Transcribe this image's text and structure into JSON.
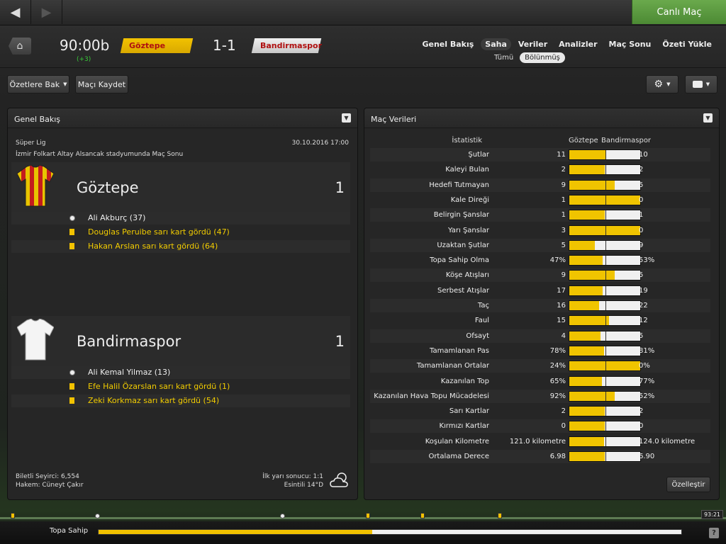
{
  "topbar": {
    "back_icon": "arrow-left-icon",
    "forward_icon": "arrow-right-icon",
    "live_label": "Canlı Maç"
  },
  "header": {
    "clock": "90:00b",
    "added_time": "(+3)",
    "home_team": "Göztepe",
    "score": "1-1",
    "away_team": "Bandirmaspor",
    "tabs": [
      {
        "label": "Genel Bakış"
      },
      {
        "label": "Saha",
        "active": true
      },
      {
        "label": "Veriler"
      },
      {
        "label": "Analizler"
      },
      {
        "label": "Maç Sonu"
      },
      {
        "label": "Özeti Yükle"
      }
    ],
    "subtabs": [
      {
        "label": "Tümü"
      },
      {
        "label": "Bölünmüş",
        "active": true
      }
    ]
  },
  "toolbar": {
    "highlights_label": "Özetlere Bak",
    "save_label": "Maçı Kaydet"
  },
  "overview": {
    "title": "Genel Bakış",
    "league": "Süper Lig",
    "kickoff": "30.10.2016 17:00",
    "venue": "İzmir Folkart Altay Alsancak stadyumunda Maç Sonu",
    "home": {
      "name": "Göztepe",
      "goals": "1",
      "events": [
        {
          "type": "goal",
          "text": "Ali Akburç (37)"
        },
        {
          "type": "card",
          "text": "Douglas Peruibe sarı kart gördü (47)"
        },
        {
          "type": "card",
          "text": "Hakan Arslan sarı kart gördü (64)"
        }
      ]
    },
    "away": {
      "name": "Bandirmaspor",
      "goals": "1",
      "events": [
        {
          "type": "goal",
          "text": "Ali Kemal Yilmaz (13)"
        },
        {
          "type": "card",
          "text": "Efe Halil Özarslan sarı kart gördü (1)"
        },
        {
          "type": "card",
          "text": "Zeki Korkmaz sarı kart gördü (54)"
        }
      ]
    },
    "attendance": "Biletli Seyirci: 6,554",
    "referee": "Hakem: Cüneyt Çakır",
    "halftime": "İlk yarı sonucu: 1:1",
    "weather": "Esintili 14°D",
    "weather_icon": "partly-cloudy-icon"
  },
  "stats": {
    "title": "Maç Verileri",
    "col_label": "İstatistik",
    "col_home": "Göztepe",
    "col_away": "Bandirmaspor",
    "customize_label": "Özelleştir",
    "rows": [
      {
        "label": "Şutlar",
        "home": "11",
        "away": "10",
        "share": 0.52
      },
      {
        "label": "Kaleyi Bulan",
        "home": "2",
        "away": "2",
        "share": 0.5
      },
      {
        "label": "Hedefi Tutmayan",
        "home": "9",
        "away": "5",
        "share": 0.64
      },
      {
        "label": "Kale Direği",
        "home": "1",
        "away": "0",
        "share": 1.0
      },
      {
        "label": "Belirgin Şanslar",
        "home": "1",
        "away": "1",
        "share": 0.5
      },
      {
        "label": "Yarı Şanslar",
        "home": "3",
        "away": "0",
        "share": 1.0
      },
      {
        "label": "Uzaktan Şutlar",
        "home": "5",
        "away": "9",
        "share": 0.36
      },
      {
        "label": "Topa Sahip Olma",
        "home": "47%",
        "away": "53%",
        "share": 0.47
      },
      {
        "label": "Köşe Atışları",
        "home": "9",
        "away": "5",
        "share": 0.64
      },
      {
        "label": "Serbest Atışlar",
        "home": "17",
        "away": "19",
        "share": 0.47
      },
      {
        "label": "Taç",
        "home": "16",
        "away": "22",
        "share": 0.42
      },
      {
        "label": "Faul",
        "home": "15",
        "away": "12",
        "share": 0.56
      },
      {
        "label": "Ofsayt",
        "home": "4",
        "away": "5",
        "share": 0.44
      },
      {
        "label": "Tamamlanan Pas",
        "home": "78%",
        "away": "81%",
        "share": 0.49
      },
      {
        "label": "Tamamlanan Ortalar",
        "home": "24%",
        "away": "0%",
        "share": 1.0
      },
      {
        "label": "Kazanılan Top",
        "home": "65%",
        "away": "77%",
        "share": 0.46
      },
      {
        "label": "Kazanılan Hava Topu Mücadelesi",
        "home": "92%",
        "away": "52%",
        "share": 0.64
      },
      {
        "label": "Sarı Kartlar",
        "home": "2",
        "away": "2",
        "share": 0.5
      },
      {
        "label": "Kırmızı Kartlar",
        "home": "0",
        "away": "0",
        "share": 0.5
      },
      {
        "label": "Koşulan Kilometre",
        "home": "121.0 kilometre",
        "away": "124.0 kilometre",
        "share": 0.49
      },
      {
        "label": "Ortalama Derece",
        "home": "6.98",
        "away": "6.90",
        "share": 0.5
      }
    ]
  },
  "timeline": {
    "time": "93:21",
    "cards_minutes": [
      1,
      47,
      54,
      64
    ],
    "goal_minutes": [
      13,
      37
    ]
  },
  "bottom": {
    "possession_label": "Topa Sahip",
    "possession_home_share": 0.47,
    "help_label": "?"
  }
}
